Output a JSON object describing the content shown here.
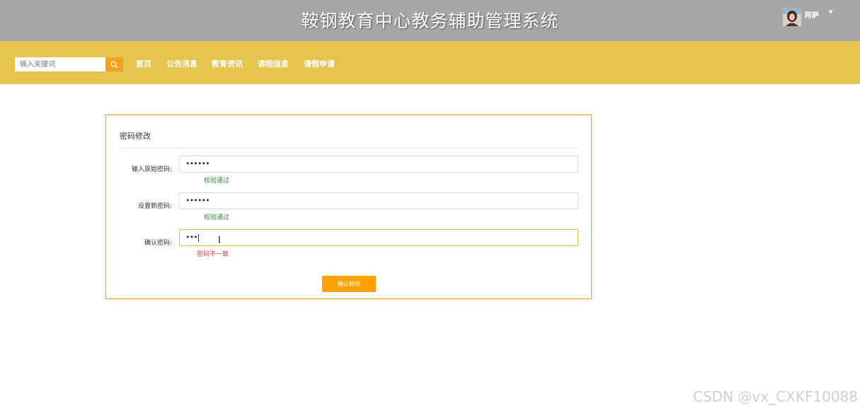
{
  "header": {
    "title": "鞍钢教育中心教务辅助管理系统",
    "user_name": "阿萨",
    "user_menu_icon": "caret-down-icon"
  },
  "navbar": {
    "search_placeholder": "输入关键词",
    "search_icon": "search-icon",
    "items": [
      "首页",
      "公告消息",
      "教育资讯",
      "课程信息",
      "请假申请"
    ]
  },
  "form": {
    "title": "密码修改",
    "fields": [
      {
        "label": "输入原始密码:",
        "value": "••••••",
        "hint": "校验通过",
        "hint_status": "ok"
      },
      {
        "label": "设置新密码:",
        "value": "••••••",
        "hint": "校验通过",
        "hint_status": "ok"
      },
      {
        "label": "确认密码:",
        "value": "•••",
        "hint": "密码不一致",
        "hint_status": "error"
      }
    ],
    "submit_label": "确认修改"
  },
  "watermark": "CSDN @vx_CXKF10088",
  "colors": {
    "header_bg": "#a7a7a7",
    "nav_bg": "#e5c44e",
    "accent": "#ffa200",
    "ok": "#2f8a3a",
    "error": "#e04040"
  }
}
